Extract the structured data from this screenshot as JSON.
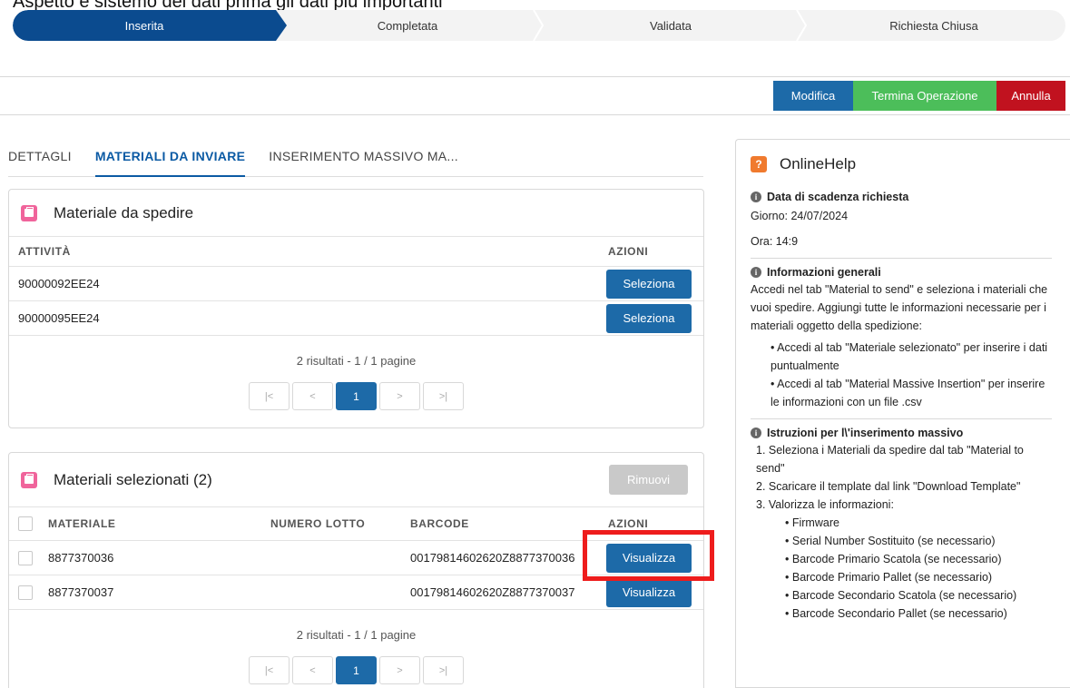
{
  "top_cut_text": "Aspetto e sistemo dei dati prima gli dati più importanti",
  "path": {
    "steps": [
      "Inserita",
      "Completata",
      "Validata",
      "Richiesta Chiusa"
    ]
  },
  "actions": {
    "modifica": "Modifica",
    "termina": "Termina Operazione",
    "annulla": "Annulla"
  },
  "tabs": [
    "DETTAGLI",
    "MATERIALI DA INVIARE",
    "INSERIMENTO MASSIVO MA..."
  ],
  "materiale_da_spedire": {
    "title": "Materiale da spedire",
    "col_attivita": "ATTIVITÀ",
    "col_azioni": "AZIONI",
    "rows": [
      {
        "attivita": "90000092EE24",
        "action": "Seleziona"
      },
      {
        "attivita": "90000095EE24",
        "action": "Seleziona"
      }
    ],
    "pager_text": "2 risultati - 1 / 1 pagine",
    "pager": {
      "first": "|<",
      "prev": "<",
      "page": "1",
      "next": ">",
      "last": ">|"
    }
  },
  "materiali_selezionati": {
    "title": "Materiali selezionati (2)",
    "remove": "Rimuovi",
    "col_materiale": "MATERIALE",
    "col_lotto": "NUMERO LOTTO",
    "col_barcode": "BARCODE",
    "col_azioni": "AZIONI",
    "rows": [
      {
        "materiale": "8877370036",
        "lotto": "",
        "barcode": "00179814602620Z8877370036",
        "action": "Visualizza"
      },
      {
        "materiale": "8877370037",
        "lotto": "",
        "barcode": "00179814602620Z8877370037",
        "action": "Visualizza"
      }
    ],
    "pager_text": "2 risultati - 1 / 1 pagine",
    "pager": {
      "first": "|<",
      "prev": "<",
      "page": "1",
      "next": ">",
      "last": ">|"
    }
  },
  "help": {
    "title": "OnlineHelp",
    "icon_glyph": "?",
    "info_glyph": "i",
    "scadenza_title": "Data di scadenza richiesta",
    "giorno": "Giorno: 24/07/2024",
    "ora": "Ora: 14:9",
    "generali_title": "Informazioni generali",
    "generali_text": "Accedi nel tab \"Material to send\" e seleziona i materiali che vuoi spedire. Aggiungi tutte le informazioni necessarie per i materiali oggetto della spedizione:",
    "generali_bullets": [
      "Accedi al tab \"Materiale selezionato\" per inserire i dati puntualmente",
      "Accedi al tab \"Material Massive Insertion\" per inserire le informazioni con un file .csv"
    ],
    "istruzioni_title": "Istruzioni per l\\'inserimento massivo",
    "istruzioni_steps": [
      "1. Seleziona i Materiali da spedire dal tab \"Material to send\"",
      "2. Scaricare il template dal link \"Download Template\"",
      "3. Valorizza le informazioni:"
    ],
    "istruzioni_sub": [
      "Firmware",
      "Serial Number Sostituito (se necessario)",
      "Barcode Primario Scatola (se necessario)",
      "Barcode Primario Pallet (se necessario)",
      "Barcode Secondario Scatola (se necessario)",
      "Barcode Secondario Pallet (se necessario)"
    ]
  },
  "colors": {
    "primary": "#0b4b8f",
    "button_blue": "#1d6aa8",
    "green": "#4cbe5a",
    "red": "#c1121f",
    "highlight": "#ee1c1c",
    "card_icon": "#f0649b",
    "help_icon": "#f07a2e"
  }
}
